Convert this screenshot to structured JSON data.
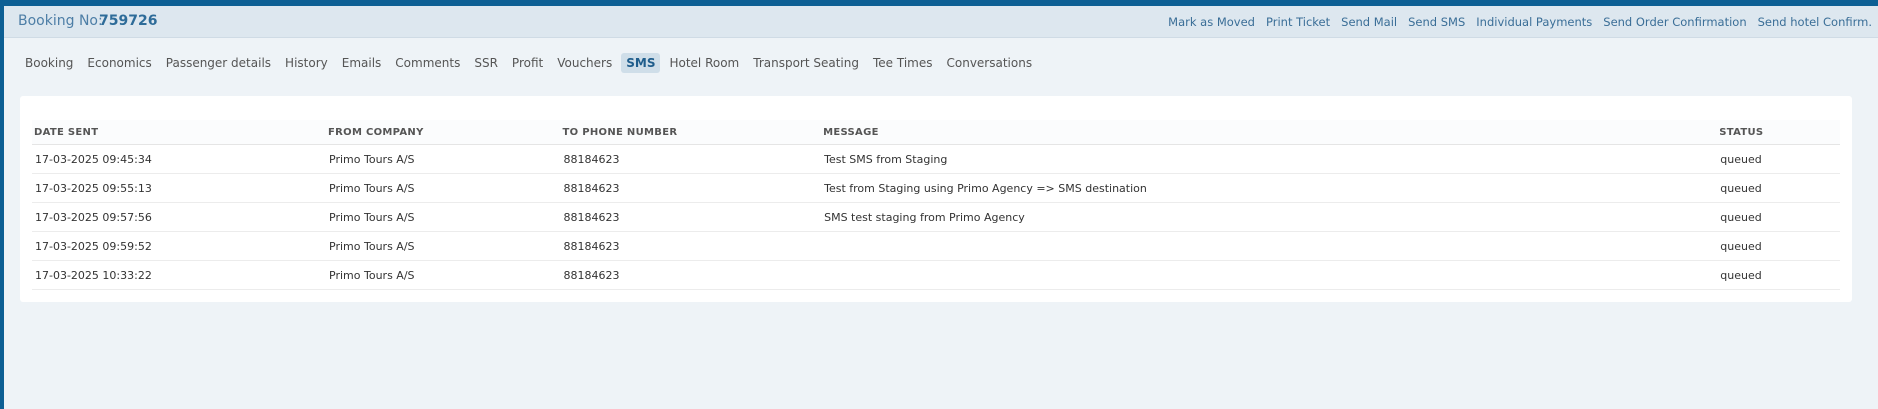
{
  "header": {
    "booking_label": "Booking No:",
    "booking_number": "759726",
    "actions": [
      "Mark as Moved",
      "Print Ticket",
      "Send Mail",
      "Send SMS",
      "Individual Payments",
      "Send Order Confirmation",
      "Send hotel Confirm."
    ]
  },
  "tabs": [
    {
      "label": "Booking",
      "active": false
    },
    {
      "label": "Economics",
      "active": false
    },
    {
      "label": "Passenger details",
      "active": false
    },
    {
      "label": "History",
      "active": false
    },
    {
      "label": "Emails",
      "active": false
    },
    {
      "label": "Comments",
      "active": false
    },
    {
      "label": "SSR",
      "active": false
    },
    {
      "label": "Profit",
      "active": false
    },
    {
      "label": "Vouchers",
      "active": false
    },
    {
      "label": "SMS",
      "active": true
    },
    {
      "label": "Hotel Room",
      "active": false
    },
    {
      "label": "Transport Seating",
      "active": false
    },
    {
      "label": "Tee Times",
      "active": false
    },
    {
      "label": "Conversations",
      "active": false
    }
  ],
  "table": {
    "columns": [
      "DATE SENT",
      "FROM COMPANY",
      "TO PHONE NUMBER",
      "MESSAGE",
      "STATUS"
    ],
    "rows": [
      {
        "date": "17-03-2025 09:45:34",
        "from": "Primo Tours A/S",
        "phone": "88184623",
        "message": "Test SMS from Staging",
        "status": "queued"
      },
      {
        "date": "17-03-2025 09:55:13",
        "from": "Primo Tours A/S",
        "phone": "88184623",
        "message": "Test from Staging using Primo Agency => SMS destination",
        "status": "queued"
      },
      {
        "date": "17-03-2025 09:57:56",
        "from": "Primo Tours A/S",
        "phone": "88184623",
        "message": "SMS test staging from Primo Agency",
        "status": "queued"
      },
      {
        "date": "17-03-2025 09:59:52",
        "from": "Primo Tours A/S",
        "phone": "88184623",
        "message": "",
        "status": "queued"
      },
      {
        "date": "17-03-2025 10:33:22",
        "from": "Primo Tours A/S",
        "phone": "88184623",
        "message": "",
        "status": "queued"
      }
    ]
  },
  "colors": {
    "brand": "#0d5f94",
    "active_tab_bg": "#cfdee9",
    "page_bg": "#eef3f7"
  }
}
